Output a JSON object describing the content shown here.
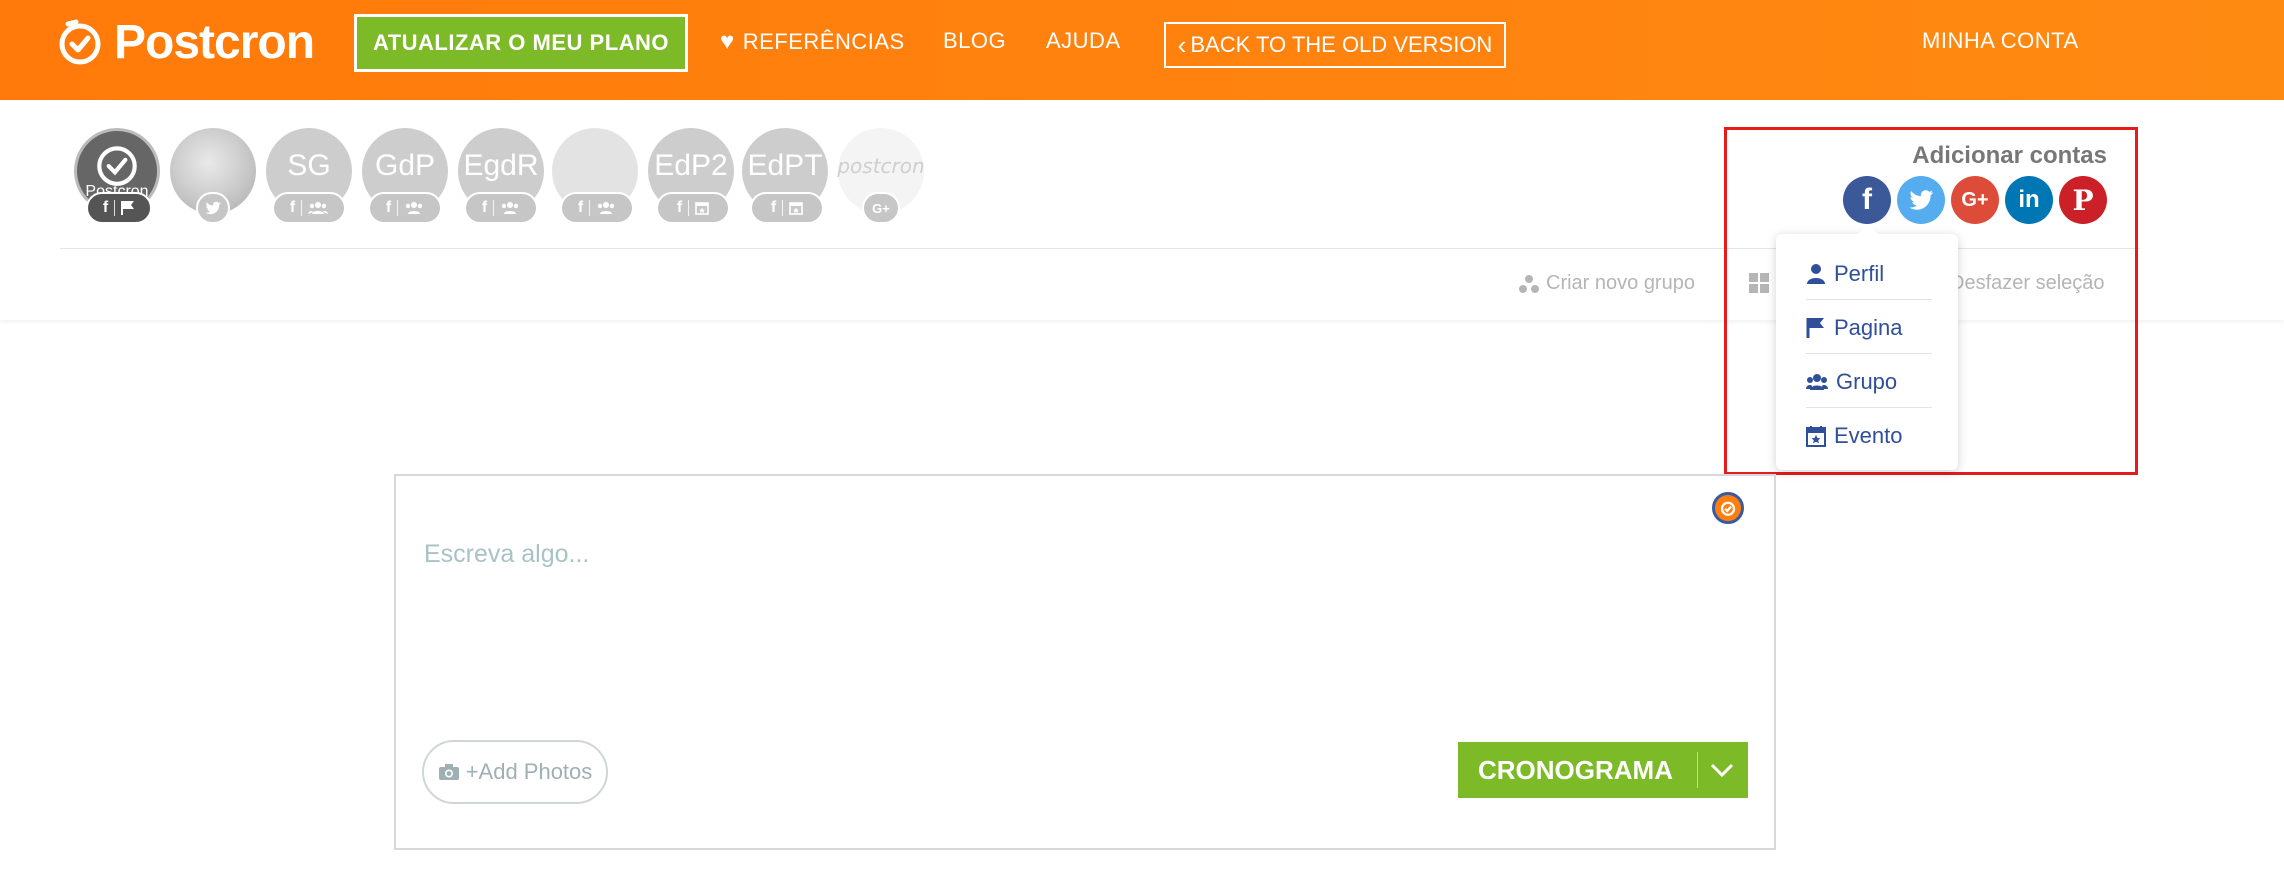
{
  "header": {
    "logo_text": "Postcron",
    "upgrade_label": "ATUALIZAR O MEU PLANO",
    "references_label": "REFERÊNCIAS",
    "blog_label": "BLOG",
    "help_label": "AJUDA",
    "old_version_label": "BACK TO THE OLD VERSION",
    "account_label": "MINHA CONTA"
  },
  "accounts": [
    {
      "initials": "",
      "caption": "Postcron",
      "badge_icons": [
        "facebook-icon",
        "flag-icon"
      ],
      "selected": true
    },
    {
      "initials": "",
      "caption": "",
      "badge_icons": [
        "twitter-icon"
      ]
    },
    {
      "initials": "SG",
      "badge_icons": [
        "facebook-icon",
        "group-icon"
      ]
    },
    {
      "initials": "GdP",
      "badge_icons": [
        "facebook-icon",
        "group-icon"
      ]
    },
    {
      "initials": "EgdR",
      "badge_icons": [
        "facebook-icon",
        "group-icon"
      ]
    },
    {
      "initials": "",
      "badge_icons": [
        "facebook-icon",
        "group-icon"
      ]
    },
    {
      "initials": "EdP2",
      "badge_icons": [
        "facebook-icon",
        "event-icon"
      ]
    },
    {
      "initials": "EdPT",
      "badge_icons": [
        "facebook-icon",
        "event-icon"
      ]
    },
    {
      "initials": "postcron",
      "badge_icons": [
        "google-plus-icon"
      ]
    }
  ],
  "group_actions": {
    "create_group": "Criar novo grupo",
    "undo_selection": "Desfazer seleção"
  },
  "add_accounts": {
    "title": "Adicionar contas",
    "networks": [
      {
        "name": "facebook",
        "glyph": "f",
        "color": "#3b5998"
      },
      {
        "name": "twitter",
        "glyph": "t",
        "color": "#55acee"
      },
      {
        "name": "google-plus",
        "glyph": "G+",
        "color": "#dd4b39"
      },
      {
        "name": "linkedin",
        "glyph": "in",
        "color": "#0077b5"
      },
      {
        "name": "pinterest",
        "glyph": "P",
        "color": "#cb2027"
      }
    ],
    "menu": [
      {
        "label": "Perfil",
        "icon": "user-icon"
      },
      {
        "label": "Pagina",
        "icon": "flag-icon"
      },
      {
        "label": "Grupo",
        "icon": "group-icon"
      },
      {
        "label": "Evento",
        "icon": "event-icon"
      }
    ]
  },
  "composer": {
    "placeholder": "Escreva algo...",
    "add_photos_label": "+Add Photos",
    "schedule_label": "CRONOGRAMA"
  },
  "colors": {
    "brand_orange": "#ff7a0a",
    "action_green": "#7dba28",
    "highlight_red": "#e51c1c",
    "menu_blue": "#2f4f99"
  }
}
